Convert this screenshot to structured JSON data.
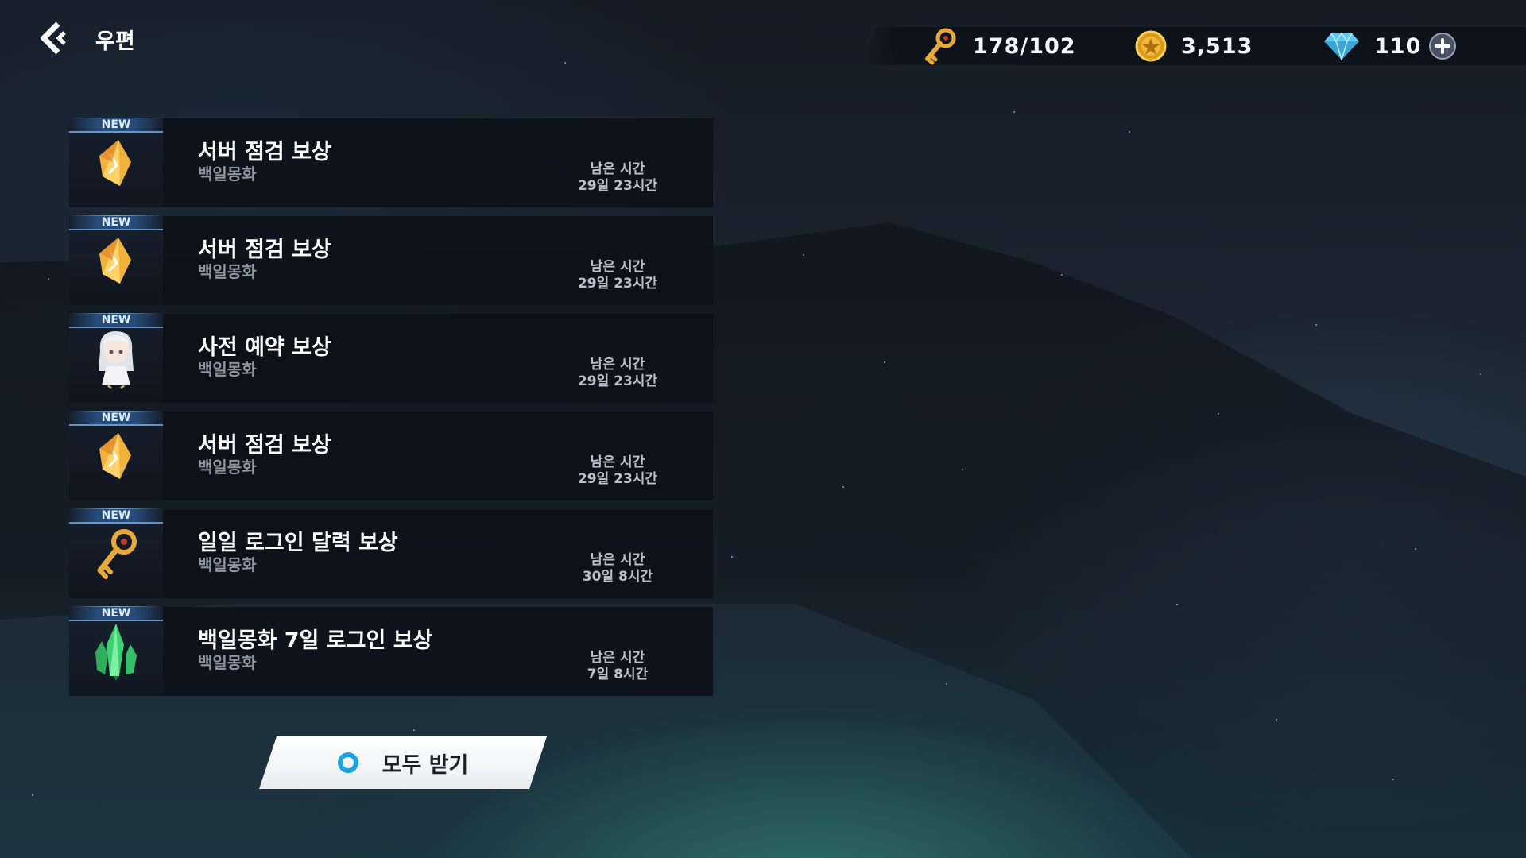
{
  "header": {
    "title": "우편"
  },
  "resources": {
    "keys": {
      "value": "178/102",
      "icon": "gold-key-icon"
    },
    "coins": {
      "value": "3,513",
      "icon": "gold-coin-icon"
    },
    "gems": {
      "value": "110",
      "icon": "diamond-icon"
    }
  },
  "mail": {
    "new_label": "NEW",
    "remaining_label": "남은 시간",
    "items": [
      {
        "title": "서버 점검 보상",
        "sender": "백일몽화",
        "remaining": "29일 23시간",
        "icon": "crystal-shard-icon"
      },
      {
        "title": "서버 점검 보상",
        "sender": "백일몽화",
        "remaining": "29일 23시간",
        "icon": "crystal-shard-icon"
      },
      {
        "title": "사전 예약 보상",
        "sender": "백일몽화",
        "remaining": "29일 23시간",
        "icon": "chibi-character-icon"
      },
      {
        "title": "서버 점검 보상",
        "sender": "백일몽화",
        "remaining": "29일 23시간",
        "icon": "crystal-shard-icon"
      },
      {
        "title": "일일 로그인 달력 보상",
        "sender": "백일몽화",
        "remaining": "30일 8시간",
        "icon": "gold-key-icon"
      },
      {
        "title": "백일몽화 7일 로그인 보상",
        "sender": "백일몽화",
        "remaining": "7일 8시간",
        "icon": "green-crystal-icon"
      }
    ]
  },
  "claim_all": {
    "label": "모두 받기"
  },
  "colors": {
    "accent": "#1aa3e8",
    "panel": "#0d1118",
    "text_secondary": "#8c95a3"
  }
}
